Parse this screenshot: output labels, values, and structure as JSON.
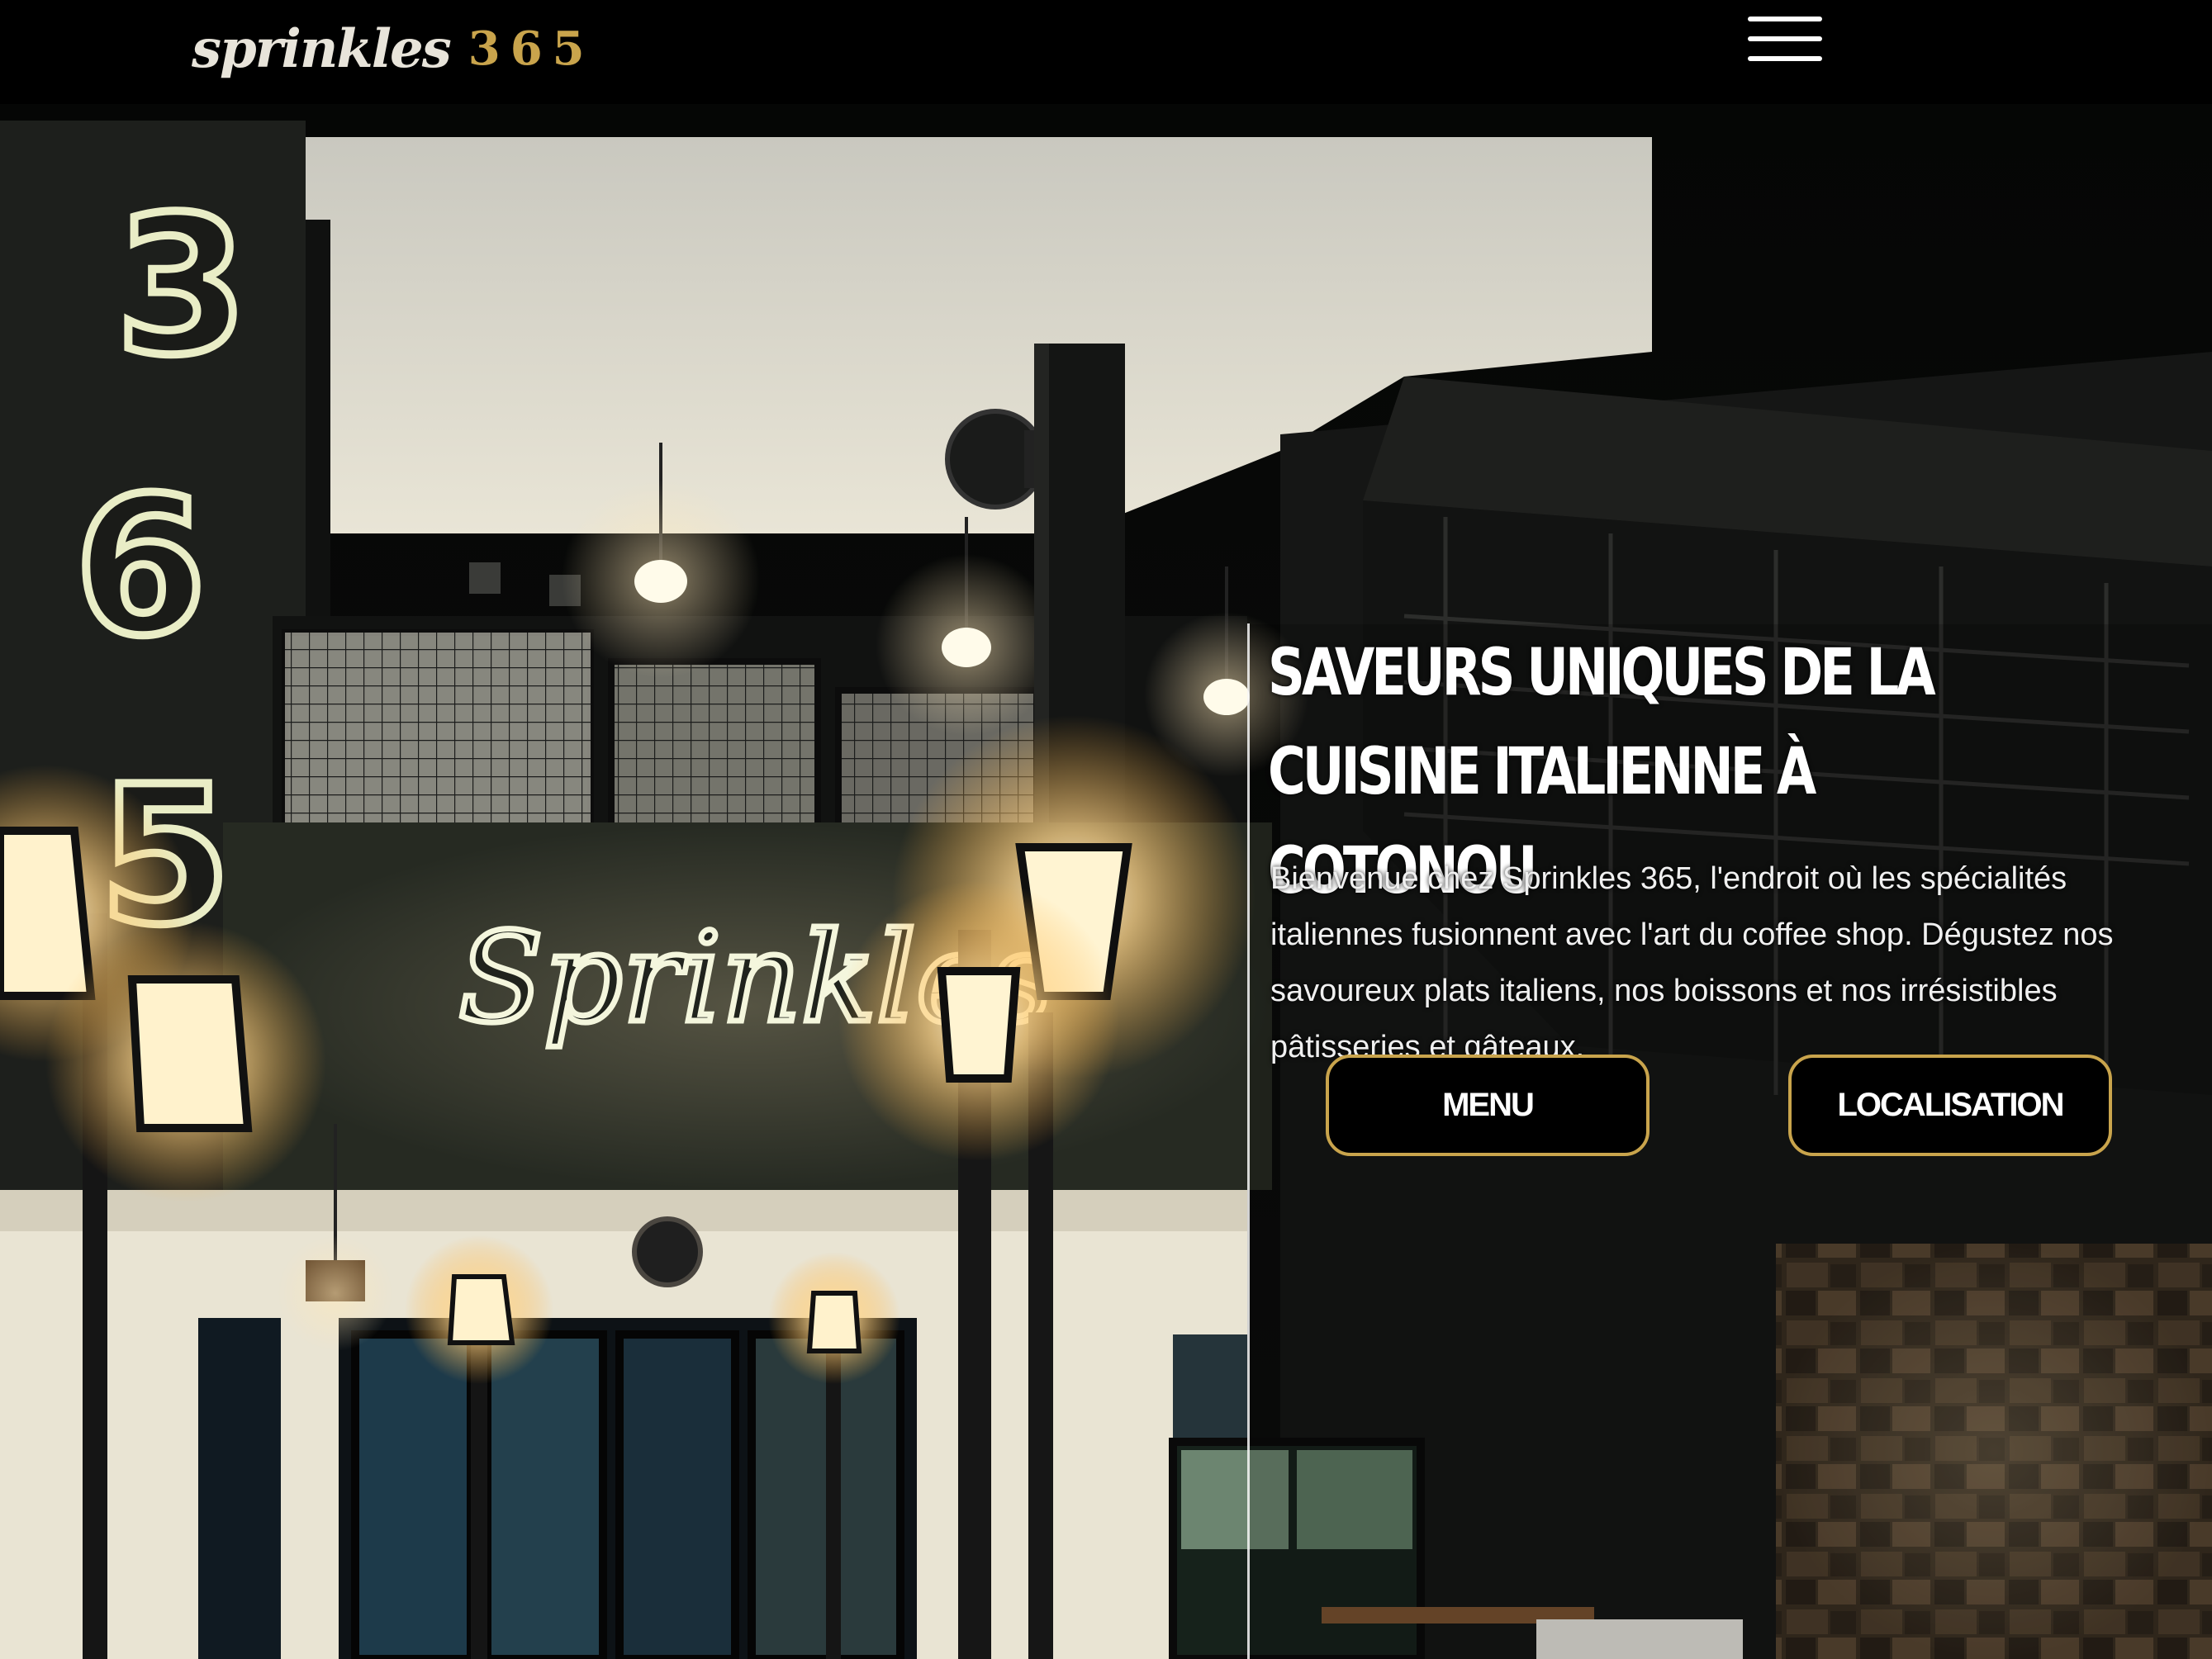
{
  "header": {
    "logo_script": "sprinkles",
    "logo_number": "365",
    "menu_icon": "hamburger-menu-icon"
  },
  "hero": {
    "sign_numbers": [
      "3",
      "6",
      "5"
    ],
    "sign_script": "Sprinkles",
    "title": "SAVEURS UNIQUES DE LA CUISINE ITALIENNE À COTONOU",
    "text": "Bienvenue chez Sprinkles 365, l'endroit où les spécialités italiennes fusionnent avec l'art du coffee shop. Dégustez nos savoureux plats italiens, nos boissons et nos irrésistibles pâtisseries et gâteaux.",
    "buttons": {
      "menu": "MENU",
      "location": "LOCALISATION"
    }
  },
  "colors": {
    "accent_gold": "#c9a44c",
    "background": "#000000"
  }
}
